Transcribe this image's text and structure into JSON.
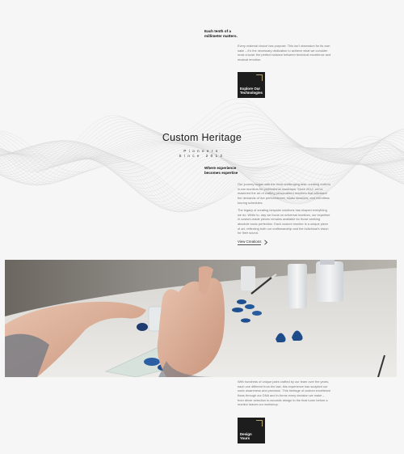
{
  "intro": {
    "heading": "Each tenth of a millimeter matters.",
    "paragraph": "Every material choice has purpose. This isn't obsession for its own sake – it's the necessary dedication to achieve what we consider most crucial: the perfect balance between technical excellence and musical emotion.",
    "cta_label": "Explore Our Technologies"
  },
  "hero": {
    "title": "Custom Heritage",
    "tagline_line1": "Pioneers",
    "tagline_line2": "Since 2012"
  },
  "story": {
    "heading": "Where experience becomes expertise",
    "paragraph1": "Our journey began with the most challenging task: creating custom in-ear monitors for professional musicians. Since 2012, we've mastered the art of crafting personalized monitors that withstand the demands of live performances, studio sessions, and relentless touring schedules.",
    "paragraph2": "The legacy of creating bespoke solutions has shaped everything we do. While to- day we focus on universal monitors, our expertise in custom-made pieces remains available for those seeking absolute sonic perfection. Each custom monitor is a unique piece of art, reflecting both our craftsmanship and the individual's vision for their sound.",
    "link_label": "View Creations",
    "link_icon": "chevron-right-icon"
  },
  "image": {
    "description_icon": "photo-icon"
  },
  "design": {
    "paragraph": "With hundreds of unique pairs crafted by our team over the years, each one different from the last, this experience has sculpted our sonic awareness and precision. This heritage of custom excellence flows through our DNA and in-forms every decision we make – from driver selection to acoustic design to the final tuner before a monitor leaves our workshop.",
    "cta_label": "Design Yours"
  },
  "colors": {
    "background": "#f6f6f6",
    "cta_background": "#1d1d1d",
    "accent": "#b9a575",
    "earpiece_blue": "#1f4f8f"
  }
}
